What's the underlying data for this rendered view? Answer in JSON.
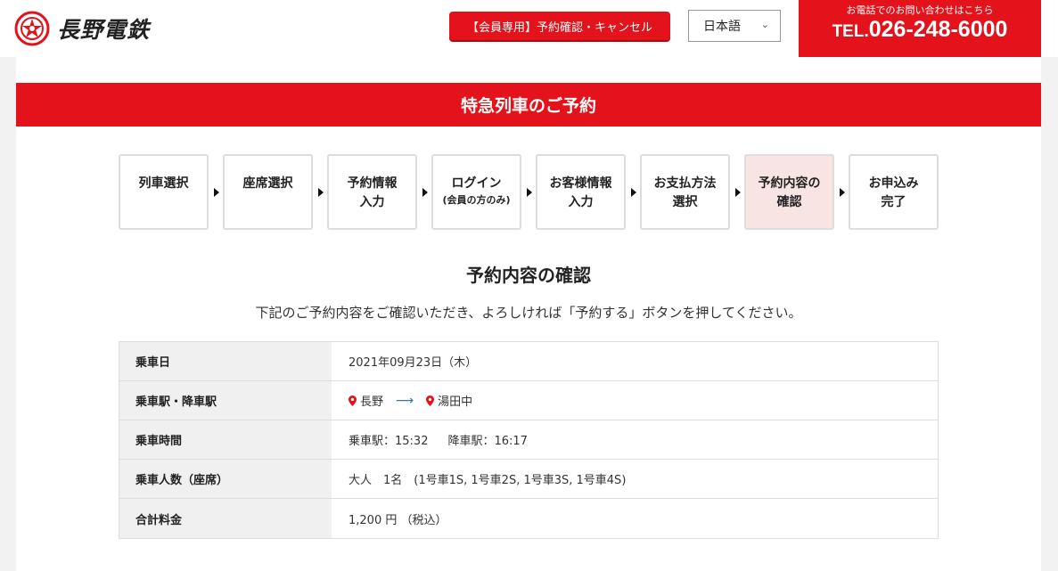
{
  "header": {
    "brand": "長野電鉄",
    "member_button": "【会員専用】予約確認・キャンセル",
    "language": "日本語",
    "tel_note": "お電話でのお問い合わせはこちら",
    "tel_prefix": "TEL.",
    "tel_number": "026-248-6000"
  },
  "page_title": "特急列車のご予約",
  "steps": [
    {
      "line1": "列車選択",
      "line2": ""
    },
    {
      "line1": "座席選択",
      "line2": ""
    },
    {
      "line1": "予約情報",
      "line2": "入力"
    },
    {
      "line1": "ログイン",
      "line2": "(会員の方のみ)"
    },
    {
      "line1": "お客様情報",
      "line2": "入力"
    },
    {
      "line1": "お支払方法",
      "line2": "選択"
    },
    {
      "line1": "予約内容の",
      "line2": "確認"
    },
    {
      "line1": "お申込み",
      "line2": "完了"
    }
  ],
  "section_title": "予約内容の確認",
  "instruction": "下記のご予約内容をご確認いただき、よろしければ「予約する」ボタンを押してください。",
  "details": {
    "date_label": "乗車日",
    "date_value": "2021年09月23日（木）",
    "stations_label": "乗車駅・降車駅",
    "from_station": "長野",
    "to_station": "湯田中",
    "route_arrow": "⟶",
    "time_label": "乗車時間",
    "board_time": "乗車駅：15:32",
    "alight_time": "降車駅：16:17",
    "passengers_label": "乗車人数（座席）",
    "passengers_value": "大人　1名　(1号車1S, 1号車2S, 1号車3S, 1号車4S)",
    "fare_label": "合計料金",
    "fare_value": "1,200 円 （税込）"
  },
  "colors": {
    "brand_red": "#e3121b",
    "active_step_bg": "#f9e4e4",
    "route_arrow": "#3b6fb6"
  }
}
